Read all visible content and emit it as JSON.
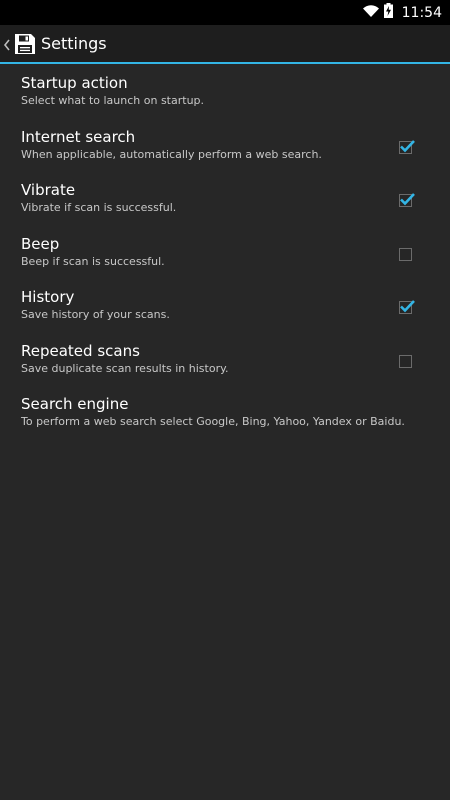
{
  "status_bar": {
    "time": "11:54",
    "icons": [
      "wifi-icon",
      "battery-charging-icon"
    ]
  },
  "action_bar": {
    "title": "Settings",
    "up_icon": "chevron-left-icon",
    "app_icon": "floppy-disk-icon"
  },
  "colors": {
    "accent": "#33b5e5",
    "background": "#272727",
    "summary_text": "#c8c8c8"
  },
  "preferences": [
    {
      "title": "Startup action",
      "summary": "Select what to launch on startup.",
      "has_checkbox": false
    },
    {
      "title": "Internet search",
      "summary": "When applicable, automatically perform a web search.",
      "has_checkbox": true,
      "checked": true
    },
    {
      "title": "Vibrate",
      "summary": "Vibrate if scan is successful.",
      "has_checkbox": true,
      "checked": true
    },
    {
      "title": "Beep",
      "summary": "Beep if scan is successful.",
      "has_checkbox": true,
      "checked": false
    },
    {
      "title": "History",
      "summary": "Save history of your scans.",
      "has_checkbox": true,
      "checked": true
    },
    {
      "title": "Repeated scans",
      "summary": "Save duplicate scan results in history.",
      "has_checkbox": true,
      "checked": false
    },
    {
      "title": "Search engine",
      "summary": "To perform a web search select Google, Bing, Yahoo, Yandex or Baidu.",
      "has_checkbox": false
    }
  ]
}
